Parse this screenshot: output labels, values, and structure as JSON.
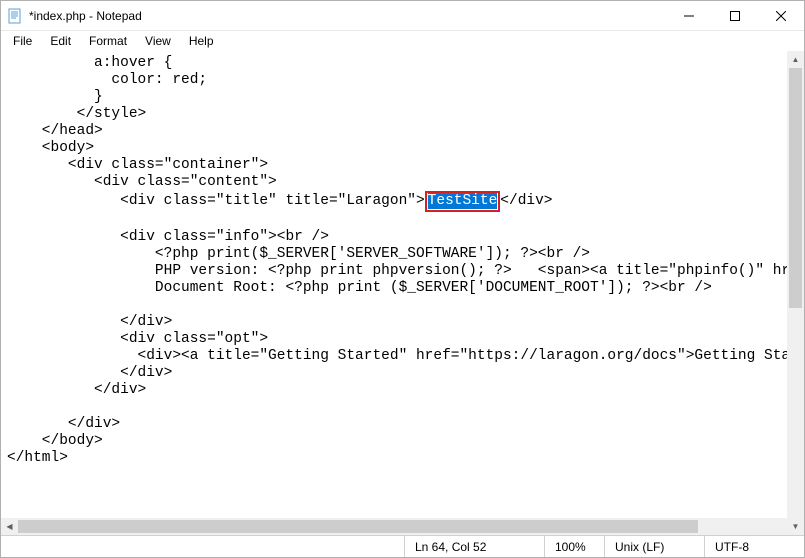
{
  "window": {
    "title": "*index.php - Notepad"
  },
  "menu": {
    "items": [
      "File",
      "Edit",
      "Format",
      "View",
      "Help"
    ]
  },
  "editor": {
    "lines_before": "          a:hover {\n            color: red;\n          }\n        </style>\n    </head>\n    <body>\n       <div class=\"container\">\n          <div class=\"content\">\n             <div class=\"title\" title=\"Laragon\">",
    "selected_text": "TestSite",
    "lines_after1": "</div>\n\n             <div class=\"info\"><br />\n                 <?php print($_SERVER['SERVER_SOFTWARE']); ?><br />\n                 PHP version: <?php print phpversion(); ?>   <span><a title=\"phpinfo()\" href\n                 Document Root: <?php print ($_SERVER['DOCUMENT_ROOT']); ?><br />\n\n             </div>\n             <div class=\"opt\">\n               <div><a title=\"Getting Started\" href=\"https://laragon.org/docs\">Getting Started\n             </div>\n          </div>\n\n       </div>\n    </body>\n</html>"
  },
  "status": {
    "position": "Ln 64, Col 52",
    "zoom": "100%",
    "line_ending": "Unix (LF)",
    "encoding": "UTF-8"
  }
}
